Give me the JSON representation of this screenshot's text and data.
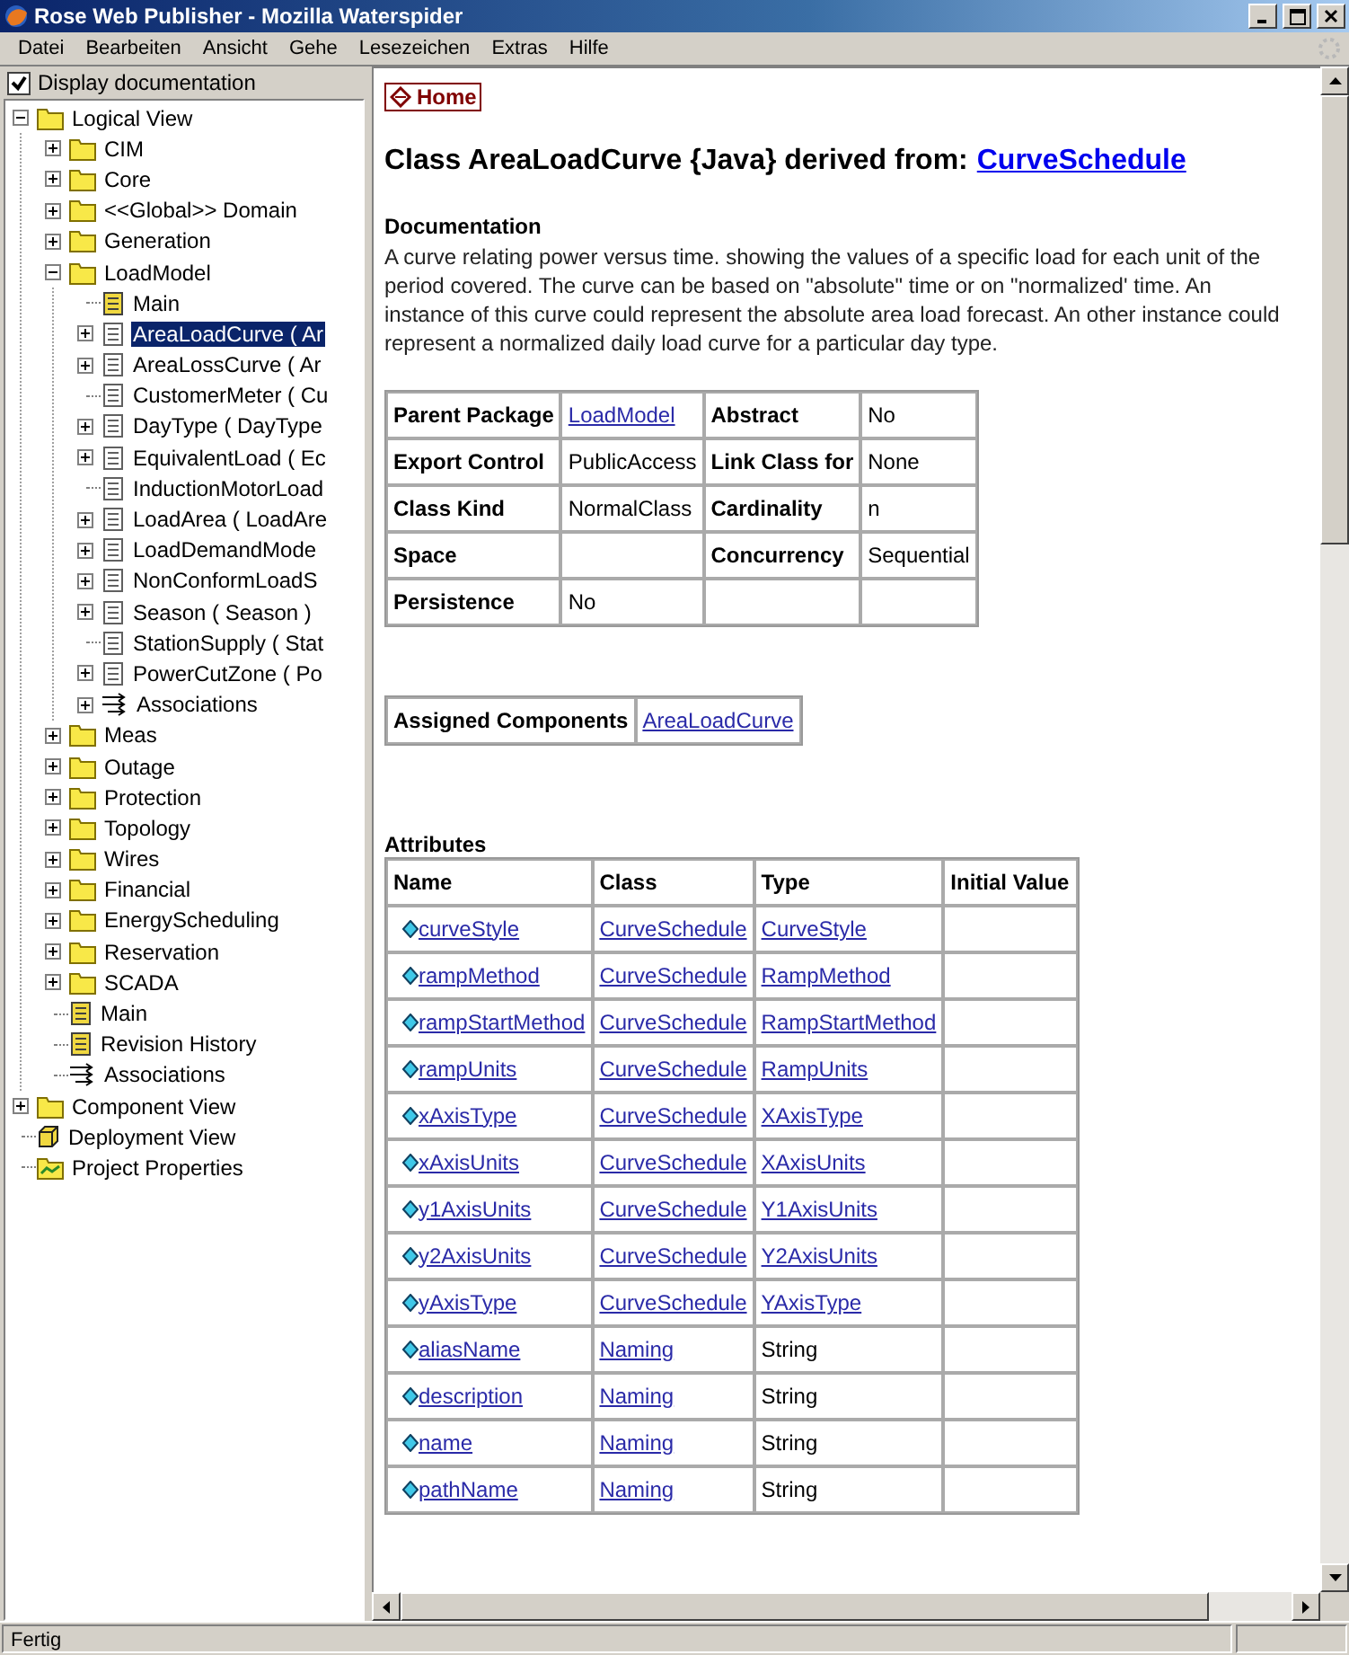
{
  "window": {
    "title": "Rose Web Publisher - Mozilla Waterspider"
  },
  "menu": [
    {
      "label": "Datei"
    },
    {
      "label": "Bearbeiten"
    },
    {
      "label": "Ansicht"
    },
    {
      "label": "Gehe"
    },
    {
      "label": "Lesezeichen"
    },
    {
      "label": "Extras"
    },
    {
      "label": "Hilfe"
    }
  ],
  "sidebar": {
    "display_documentation": {
      "label": "Display documentation",
      "checked": true
    },
    "tree": [
      {
        "label": "Logical View",
        "kind": "folder",
        "expanded": true,
        "selected": false,
        "children": [
          {
            "label": "CIM",
            "kind": "folder",
            "expanded": false,
            "selected": false
          },
          {
            "label": "Core",
            "kind": "folder",
            "expanded": false,
            "selected": false
          },
          {
            "label": "<<Global>> Domain",
            "kind": "folder",
            "expanded": false,
            "selected": false
          },
          {
            "label": "Generation",
            "kind": "folder",
            "expanded": false,
            "selected": false
          },
          {
            "label": "LoadModel",
            "kind": "folder",
            "expanded": true,
            "selected": false,
            "children": [
              {
                "label": "Main",
                "kind": "diagram",
                "selected": false
              },
              {
                "label": "AreaLoadCurve ( Ar",
                "kind": "class",
                "expanded": false,
                "selected": true
              },
              {
                "label": "AreaLossCurve ( Ar",
                "kind": "class",
                "expanded": false,
                "selected": false
              },
              {
                "label": "CustomerMeter ( Cu",
                "kind": "class",
                "selected": false
              },
              {
                "label": "DayType ( DayType",
                "kind": "class",
                "expanded": false,
                "selected": false
              },
              {
                "label": "EquivalentLoad ( Ec",
                "kind": "class",
                "expanded": false,
                "selected": false
              },
              {
                "label": "InductionMotorLoad",
                "kind": "class",
                "selected": false
              },
              {
                "label": "LoadArea ( LoadAre",
                "kind": "class",
                "expanded": false,
                "selected": false
              },
              {
                "label": "LoadDemandMode",
                "kind": "class",
                "expanded": false,
                "selected": false
              },
              {
                "label": "NonConformLoadS",
                "kind": "class",
                "expanded": false,
                "selected": false
              },
              {
                "label": "Season ( Season )",
                "kind": "class",
                "expanded": false,
                "selected": false
              },
              {
                "label": "StationSupply ( Stat",
                "kind": "class",
                "selected": false
              },
              {
                "label": "PowerCutZone ( Po",
                "kind": "class",
                "expanded": false,
                "selected": false
              },
              {
                "label": "Associations",
                "kind": "associations",
                "expanded": false,
                "selected": false
              }
            ]
          },
          {
            "label": "Meas",
            "kind": "folder",
            "expanded": false,
            "selected": false
          },
          {
            "label": "Outage",
            "kind": "folder",
            "expanded": false,
            "selected": false
          },
          {
            "label": "Protection",
            "kind": "folder",
            "expanded": false,
            "selected": false
          },
          {
            "label": "Topology",
            "kind": "folder",
            "expanded": false,
            "selected": false
          },
          {
            "label": "Wires",
            "kind": "folder",
            "expanded": false,
            "selected": false
          },
          {
            "label": "Financial",
            "kind": "folder",
            "expanded": false,
            "selected": false
          },
          {
            "label": "EnergyScheduling",
            "kind": "folder",
            "expanded": false,
            "selected": false
          },
          {
            "label": "Reservation",
            "kind": "folder",
            "expanded": false,
            "selected": false
          },
          {
            "label": "SCADA",
            "kind": "folder",
            "expanded": false,
            "selected": false
          },
          {
            "label": "Main",
            "kind": "diagram",
            "selected": false
          },
          {
            "label": "Revision History",
            "kind": "diagram",
            "selected": false
          },
          {
            "label": "Associations",
            "kind": "associations",
            "selected": false
          }
        ]
      },
      {
        "label": "Component View",
        "kind": "folder",
        "expanded": false,
        "selected": false
      },
      {
        "label": "Deployment View",
        "kind": "deployment",
        "selected": false
      },
      {
        "label": "Project Properties",
        "kind": "properties",
        "selected": false
      }
    ]
  },
  "content": {
    "home": "Home",
    "heading": {
      "text": "Class AreaLoadCurve {Java} derived from:",
      "link": "CurveSchedule"
    },
    "documentation": {
      "title": "Documentation",
      "text": "A curve relating power versus time. showing the values of a specific load for each unit of the period covered. The curve can be based on \"absolute\" time or on \"normalized' time. An instance of this curve could represent the absolute area load forecast. An other instance could represent a normalized daily load curve for a particular day type."
    },
    "properties": [
      [
        {
          "kind": "label",
          "text": "Parent Package"
        },
        {
          "kind": "link",
          "text": "LoadModel"
        },
        {
          "kind": "label",
          "text": "Abstract"
        },
        {
          "kind": "text",
          "text": "No"
        }
      ],
      [
        {
          "kind": "label",
          "text": "Export Control"
        },
        {
          "kind": "text",
          "text": "PublicAccess"
        },
        {
          "kind": "label",
          "text": "Link Class for"
        },
        {
          "kind": "text",
          "text": "None"
        }
      ],
      [
        {
          "kind": "label",
          "text": "Class Kind"
        },
        {
          "kind": "text",
          "text": "NormalClass"
        },
        {
          "kind": "label",
          "text": "Cardinality"
        },
        {
          "kind": "text",
          "text": "n"
        }
      ],
      [
        {
          "kind": "label",
          "text": "Space"
        },
        {
          "kind": "empty"
        },
        {
          "kind": "label",
          "text": "Concurrency"
        },
        {
          "kind": "text",
          "text": "Sequential"
        }
      ],
      [
        {
          "kind": "label",
          "text": "Persistence"
        },
        {
          "kind": "text",
          "text": "No"
        },
        {
          "kind": "empty"
        },
        {
          "kind": "empty"
        }
      ]
    ],
    "assigned": {
      "label": "Assigned Components",
      "link": "AreaLoadCurve"
    },
    "attributes": {
      "title": "Attributes",
      "columns": [
        "Name",
        "Class",
        "Type",
        "Initial Value"
      ],
      "rows": [
        {
          "name": "curveStyle",
          "class": "CurveSchedule",
          "type": "CurveStyle",
          "type_link": true
        },
        {
          "name": "rampMethod",
          "class": "CurveSchedule",
          "type": "RampMethod",
          "type_link": true
        },
        {
          "name": "rampStartMethod",
          "class": "CurveSchedule",
          "type": "RampStartMethod",
          "type_link": true
        },
        {
          "name": "rampUnits",
          "class": "CurveSchedule",
          "type": "RampUnits",
          "type_link": true
        },
        {
          "name": "xAxisType",
          "class": "CurveSchedule",
          "type": "XAxisType",
          "type_link": true
        },
        {
          "name": "xAxisUnits",
          "class": "CurveSchedule",
          "type": "XAxisUnits",
          "type_link": true
        },
        {
          "name": "y1AxisUnits",
          "class": "CurveSchedule",
          "type": "Y1AxisUnits",
          "type_link": true
        },
        {
          "name": "y2AxisUnits",
          "class": "CurveSchedule",
          "type": "Y2AxisUnits",
          "type_link": true
        },
        {
          "name": "yAxisType",
          "class": "CurveSchedule",
          "type": "YAxisType",
          "type_link": true
        },
        {
          "name": "aliasName",
          "class": "Naming",
          "type": "String",
          "type_link": false
        },
        {
          "name": "description",
          "class": "Naming",
          "type": "String",
          "type_link": false
        },
        {
          "name": "name",
          "class": "Naming",
          "type": "String",
          "type_link": false
        },
        {
          "name": "pathName",
          "class": "Naming",
          "type": "String",
          "type_link": false
        }
      ]
    }
  },
  "status_bar": {
    "text": "Fertig"
  }
}
